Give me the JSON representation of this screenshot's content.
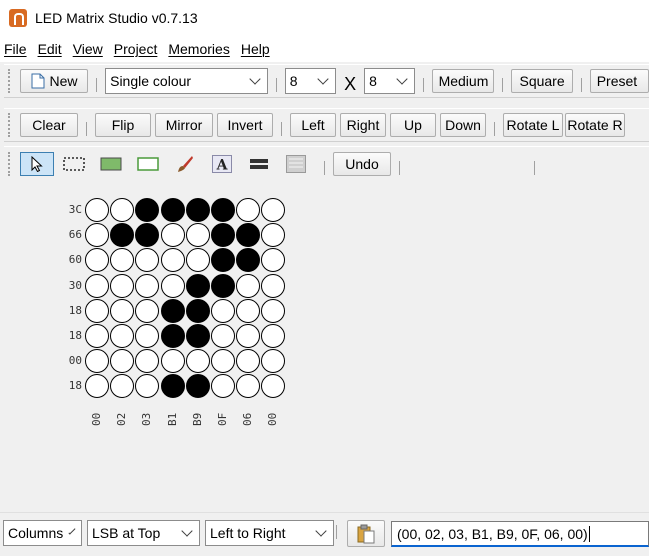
{
  "window": {
    "title": "LED Matrix Studio v0.7.13"
  },
  "menu": [
    "File",
    "Edit",
    "View",
    "Project",
    "Memories",
    "Help"
  ],
  "toolbar1": {
    "new_label": "New",
    "mode": "Single colour",
    "width": "8",
    "x_label": "X",
    "height": "8",
    "size": "Medium",
    "shape": "Square",
    "preset": "Preset"
  },
  "toolbar2": [
    "Clear",
    "Flip",
    "Mirror",
    "Invert",
    "Left",
    "Right",
    "Up",
    "Down",
    "Rotate L",
    "Rotate R"
  ],
  "toolbar3": {
    "tools": [
      "select-icon",
      "dotted-rect-icon",
      "filled-rect-icon",
      "frame-icon",
      "brush-icon",
      "text-icon",
      "line-icon",
      "pattern-icon"
    ],
    "undo_label": "Undo"
  },
  "matrix": {
    "row_labels": [
      "3C",
      "66",
      "60",
      "30",
      "18",
      "18",
      "00",
      "18"
    ],
    "col_labels": [
      "00",
      "02",
      "03",
      "B1",
      "B9",
      "0F",
      "06",
      "00"
    ],
    "rows": [
      [
        0,
        0,
        1,
        1,
        1,
        1,
        0,
        0
      ],
      [
        0,
        1,
        1,
        0,
        0,
        1,
        1,
        0
      ],
      [
        0,
        0,
        0,
        0,
        0,
        1,
        1,
        0
      ],
      [
        0,
        0,
        0,
        0,
        1,
        1,
        0,
        0
      ],
      [
        0,
        0,
        0,
        1,
        1,
        0,
        0,
        0
      ],
      [
        0,
        0,
        0,
        1,
        1,
        0,
        0,
        0
      ],
      [
        0,
        0,
        0,
        0,
        0,
        0,
        0,
        0
      ],
      [
        0,
        0,
        0,
        1,
        1,
        0,
        0,
        0
      ]
    ],
    "on_color": "#000000",
    "off_color": "#ffffff"
  },
  "bottom": {
    "direction": "Columns",
    "bit_order": "LSB at Top",
    "scan": "Left to Right",
    "output": "(00, 02, 03, B1, B9, 0F, 06, 00)"
  }
}
